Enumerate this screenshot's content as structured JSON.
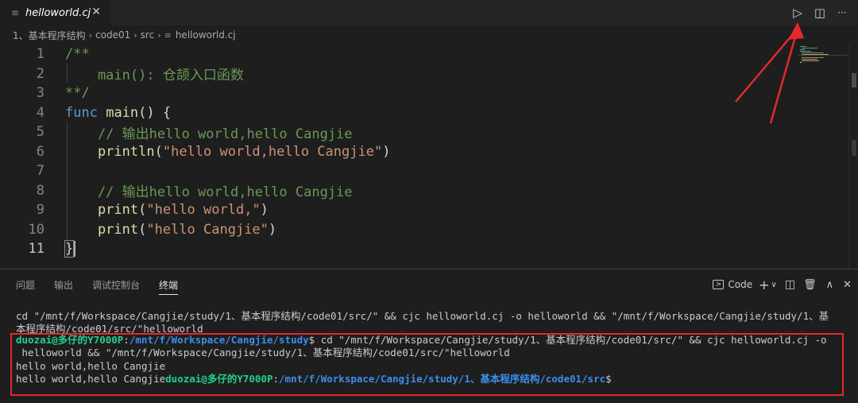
{
  "tab": {
    "title": "helloworld.cj",
    "icon": "≡",
    "close": "✕"
  },
  "toolbar": {
    "run_icon": "▷",
    "split_icon": "◫",
    "more_icon": "···"
  },
  "breadcrumb": {
    "items": [
      "1、基本程序结构",
      "code01",
      "src",
      "helloworld.cj"
    ],
    "sep": "›"
  },
  "editor": {
    "line_numbers": [
      "1",
      "2",
      "3",
      "4",
      "5",
      "6",
      "7",
      "8",
      "9",
      "10",
      "11"
    ],
    "lines": {
      "l1": "/**",
      "l2": "    main(): 仓颉入口函数",
      "l3": "**/",
      "l4_kw": "func",
      "l4_fn": "main",
      "l4_rest": "() {",
      "l5": "    // 输出hello world,hello Cangjie",
      "l6_fn": "    println",
      "l6_open": "(",
      "l6_str": "\"hello world,hello Cangjie\"",
      "l6_close": ")",
      "l8": "    // 输出hello world,hello Cangjie",
      "l9_fn": "    print",
      "l9_open": "(",
      "l9_str": "\"hello world,\"",
      "l9_close": ")",
      "l10_fn": "    print",
      "l10_open": "(",
      "l10_str": "\"hello Cangjie\"",
      "l10_close": ")",
      "l11": "}"
    }
  },
  "panel": {
    "tabs": [
      "问题",
      "输出",
      "调试控制台",
      "终端"
    ],
    "active_tab": "终端",
    "terminal_label": "Code",
    "add_icon": "+",
    "dropdown_icon": "∨",
    "split_icon": "◫",
    "trash_icon": "🗑",
    "maximize_icon": "∧",
    "close_icon": "✕"
  },
  "terminal": {
    "line1": "cd \"/mnt/f/Workspace/Cangjie/study/1、基本程序结构/code01/src/\" && cjc helloworld.cj -o helloworld && \"/mnt/f/Workspace/Cangjie/study/1、基",
    "line2": "本程序结构/code01/src/\"helloworld",
    "prompt_user": "duozai@多仔的Y7000P",
    "prompt_path1": "/mnt/f/Workspace/Cangjie/study",
    "prompt_cmd1": "$ cd \"/mnt/f/Workspace/Cangjie/study/1、基本程序结构/code01/src/\" && cjc helloworld.cj -o",
    "line4": " helloworld && \"/mnt/f/Workspace/Cangjie/study/1、基本程序结构/code01/src/\"helloworld",
    "line5": "hello world,hello Cangjie",
    "line6_out": "hello world,hello Cangjie",
    "prompt_path2": "/mnt/f/Workspace/Cangjie/study/1、基本程序结构/code01/src",
    "prompt_end": "$",
    "colon": ":"
  },
  "colors": {
    "annotation": "#e5282b",
    "prompt_user": "#23d18b",
    "prompt_path": "#3b8eea"
  }
}
